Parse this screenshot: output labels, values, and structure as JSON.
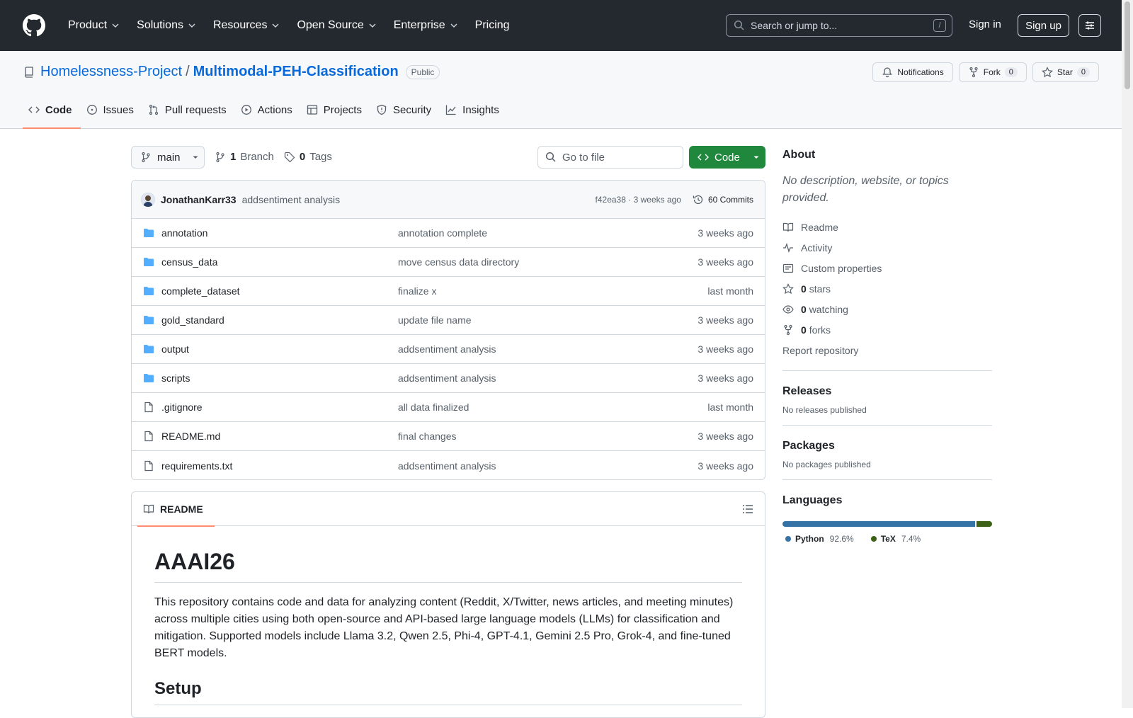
{
  "header": {
    "nav": [
      "Product",
      "Solutions",
      "Resources",
      "Open Source",
      "Enterprise",
      "Pricing"
    ],
    "search_placeholder": "Search or jump to...",
    "search_key": "/",
    "sign_in": "Sign in",
    "sign_up": "Sign up"
  },
  "repo": {
    "owner": "Homelessness-Project",
    "separator": "/",
    "name": "Multimodal-PEH-Classification",
    "visibility": "Public",
    "notifications": "Notifications",
    "fork_label": "Fork",
    "fork_count": "0",
    "star_label": "Star",
    "star_count": "0"
  },
  "tabs": [
    "Code",
    "Issues",
    "Pull requests",
    "Actions",
    "Projects",
    "Security",
    "Insights"
  ],
  "branch": {
    "current": "main",
    "branch_count": "1",
    "branch_label": "Branch",
    "tag_count": "0",
    "tag_label": "Tags",
    "go_to_file": "Go to file",
    "code_button": "Code"
  },
  "latest_commit": {
    "author": "JonathanKarr33",
    "message": "addsentiment analysis",
    "hash": "f42ea38",
    "dot": "·",
    "time": "3 weeks ago",
    "commits": "60 Commits"
  },
  "files": [
    {
      "type": "dir",
      "name": "annotation",
      "message": "annotation complete",
      "date": "3 weeks ago"
    },
    {
      "type": "dir",
      "name": "census_data",
      "message": "move census data directory",
      "date": "3 weeks ago"
    },
    {
      "type": "dir",
      "name": "complete_dataset",
      "message": "finalize x",
      "date": "last month"
    },
    {
      "type": "dir",
      "name": "gold_standard",
      "message": "update file name",
      "date": "3 weeks ago"
    },
    {
      "type": "dir",
      "name": "output",
      "message": "addsentiment analysis",
      "date": "3 weeks ago"
    },
    {
      "type": "dir",
      "name": "scripts",
      "message": "addsentiment analysis",
      "date": "3 weeks ago"
    },
    {
      "type": "file",
      "name": ".gitignore",
      "message": "all data finalized",
      "date": "last month"
    },
    {
      "type": "file",
      "name": "README.md",
      "message": "final changes",
      "date": "3 weeks ago"
    },
    {
      "type": "file",
      "name": "requirements.txt",
      "message": "addsentiment analysis",
      "date": "3 weeks ago"
    }
  ],
  "readme": {
    "tab": "README",
    "title": "AAAI26",
    "body": "This repository contains code and data for analyzing content (Reddit, X/Twitter, news articles, and meeting minutes) across multiple cities using both open-source and API-based large language models (LLMs) for classification and mitigation. Supported models include Llama 3.2, Qwen 2.5, Phi-4, GPT-4.1, Gemini 2.5 Pro, Grok-4, and fine-tuned BERT models.",
    "h2": "Setup"
  },
  "about": {
    "title": "About",
    "description": "No description, website, or topics provided.",
    "readme": "Readme",
    "activity": "Activity",
    "custom_properties": "Custom properties",
    "stars_count": "0",
    "stars_label": "stars",
    "watching_count": "0",
    "watching_label": "watching",
    "forks_count": "0",
    "forks_label": "forks",
    "report": "Report repository"
  },
  "releases": {
    "title": "Releases",
    "text": "No releases published"
  },
  "packages": {
    "title": "Packages",
    "text": "No packages published"
  },
  "languages": {
    "title": "Languages",
    "items": [
      {
        "name": "Python",
        "percent": "92.6%",
        "value": 92.6,
        "color": "#3572A5"
      },
      {
        "name": "TeX",
        "percent": "7.4%",
        "value": 7.4,
        "color": "#3D6117"
      }
    ]
  }
}
